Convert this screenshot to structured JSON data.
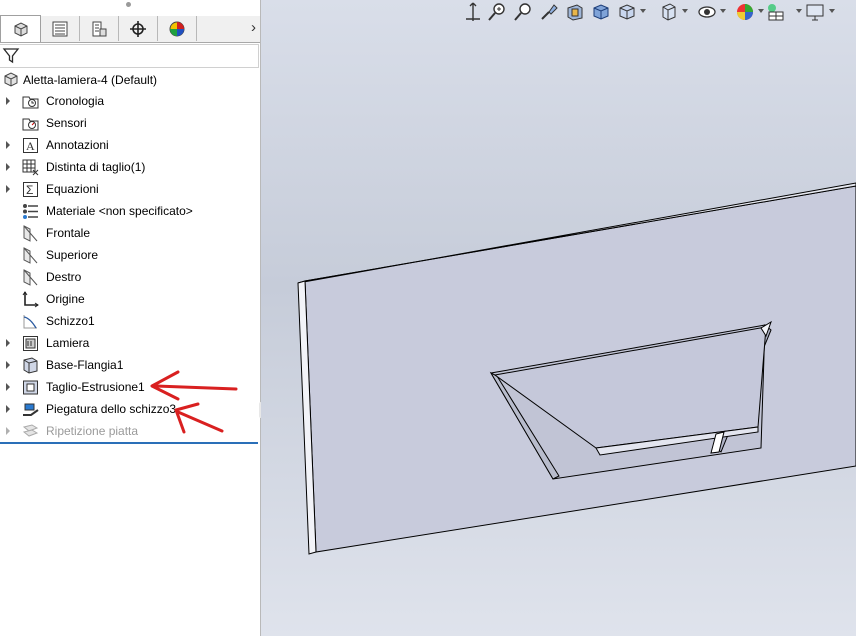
{
  "feature_manager": {
    "tabs": [
      {
        "name": "featuremanager-tree-icon",
        "active": true
      },
      {
        "name": "propertymanager-icon",
        "active": false
      },
      {
        "name": "configurationmanager-icon",
        "active": false
      },
      {
        "name": "dimxpertmanager-icon",
        "active": false
      },
      {
        "name": "displaymanager-icon",
        "active": false
      }
    ],
    "scroll_arrow": "›",
    "root_label": "Aletta-lamiera-4  (Default)",
    "items": [
      {
        "label": "Cronologia",
        "icon": "history-folder-icon",
        "expandable": true
      },
      {
        "label": "Sensori",
        "icon": "sensors-folder-icon",
        "expandable": false
      },
      {
        "label": "Annotazioni",
        "icon": "annotations-icon",
        "expandable": true
      },
      {
        "label": "Distinta di taglio(1)",
        "icon": "cut-list-icon",
        "expandable": true
      },
      {
        "label": "Equazioni",
        "icon": "equations-icon",
        "expandable": true
      },
      {
        "label": "Materiale <non specificato>",
        "icon": "material-icon",
        "expandable": false
      },
      {
        "label": "Frontale",
        "icon": "plane-icon",
        "expandable": false
      },
      {
        "label": "Superiore",
        "icon": "plane-icon",
        "expandable": false
      },
      {
        "label": "Destro",
        "icon": "plane-icon",
        "expandable": false
      },
      {
        "label": "Origine",
        "icon": "origin-icon",
        "expandable": false
      },
      {
        "label": "Schizzo1",
        "icon": "sketch-icon",
        "expandable": false
      },
      {
        "label": "Lamiera",
        "icon": "sheet-metal-icon",
        "expandable": true
      },
      {
        "label": "Base-Flangia1",
        "icon": "base-flange-icon",
        "expandable": true
      },
      {
        "label": "Taglio-Estrusione1",
        "icon": "extruded-cut-icon",
        "expandable": true
      },
      {
        "label": "Piegatura dello schizzo3",
        "icon": "sketched-bend-icon",
        "expandable": true
      },
      {
        "label": "Ripetizione piatta",
        "icon": "flat-pattern-icon",
        "expandable": true,
        "disabled": true
      }
    ]
  },
  "heads_up_toolbar": {
    "icons": [
      "zoom-to-fit-icon",
      "zoom-to-area-icon",
      "previous-view-icon",
      "section-view-icon",
      "dynamic-annotation-icon",
      "view-orientation-icon",
      "display-style-icon",
      "hide-show-items-icon",
      "edit-appearance-icon",
      "apply-scene-icon",
      "view-settings-icon"
    ]
  },
  "colors": {
    "annotation_arrow": "#d92020",
    "rollback_bar": "#2a6fb8",
    "model_face": "#c9ccdd",
    "model_edge": "#000000"
  }
}
